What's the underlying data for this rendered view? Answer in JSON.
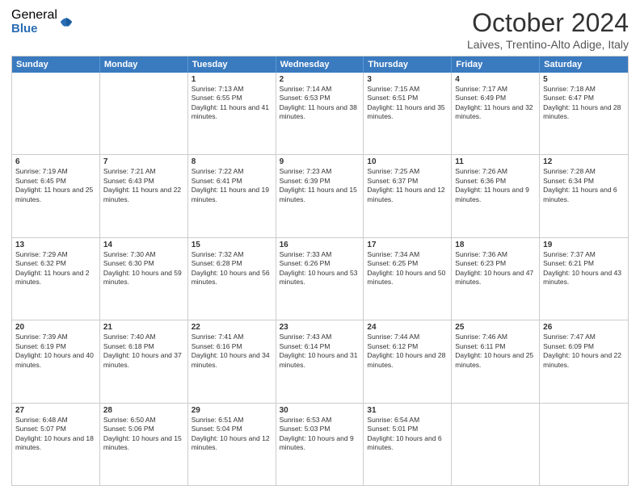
{
  "header": {
    "logo_general": "General",
    "logo_blue": "Blue",
    "month_title": "October 2024",
    "location": "Laives, Trentino-Alto Adige, Italy"
  },
  "days": [
    "Sunday",
    "Monday",
    "Tuesday",
    "Wednesday",
    "Thursday",
    "Friday",
    "Saturday"
  ],
  "weeks": [
    [
      {
        "day": "",
        "info": ""
      },
      {
        "day": "",
        "info": ""
      },
      {
        "day": "1",
        "info": "Sunrise: 7:13 AM\nSunset: 6:55 PM\nDaylight: 11 hours and 41 minutes."
      },
      {
        "day": "2",
        "info": "Sunrise: 7:14 AM\nSunset: 6:53 PM\nDaylight: 11 hours and 38 minutes."
      },
      {
        "day": "3",
        "info": "Sunrise: 7:15 AM\nSunset: 6:51 PM\nDaylight: 11 hours and 35 minutes."
      },
      {
        "day": "4",
        "info": "Sunrise: 7:17 AM\nSunset: 6:49 PM\nDaylight: 11 hours and 32 minutes."
      },
      {
        "day": "5",
        "info": "Sunrise: 7:18 AM\nSunset: 6:47 PM\nDaylight: 11 hours and 28 minutes."
      }
    ],
    [
      {
        "day": "6",
        "info": "Sunrise: 7:19 AM\nSunset: 6:45 PM\nDaylight: 11 hours and 25 minutes."
      },
      {
        "day": "7",
        "info": "Sunrise: 7:21 AM\nSunset: 6:43 PM\nDaylight: 11 hours and 22 minutes."
      },
      {
        "day": "8",
        "info": "Sunrise: 7:22 AM\nSunset: 6:41 PM\nDaylight: 11 hours and 19 minutes."
      },
      {
        "day": "9",
        "info": "Sunrise: 7:23 AM\nSunset: 6:39 PM\nDaylight: 11 hours and 15 minutes."
      },
      {
        "day": "10",
        "info": "Sunrise: 7:25 AM\nSunset: 6:37 PM\nDaylight: 11 hours and 12 minutes."
      },
      {
        "day": "11",
        "info": "Sunrise: 7:26 AM\nSunset: 6:36 PM\nDaylight: 11 hours and 9 minutes."
      },
      {
        "day": "12",
        "info": "Sunrise: 7:28 AM\nSunset: 6:34 PM\nDaylight: 11 hours and 6 minutes."
      }
    ],
    [
      {
        "day": "13",
        "info": "Sunrise: 7:29 AM\nSunset: 6:32 PM\nDaylight: 11 hours and 2 minutes."
      },
      {
        "day": "14",
        "info": "Sunrise: 7:30 AM\nSunset: 6:30 PM\nDaylight: 10 hours and 59 minutes."
      },
      {
        "day": "15",
        "info": "Sunrise: 7:32 AM\nSunset: 6:28 PM\nDaylight: 10 hours and 56 minutes."
      },
      {
        "day": "16",
        "info": "Sunrise: 7:33 AM\nSunset: 6:26 PM\nDaylight: 10 hours and 53 minutes."
      },
      {
        "day": "17",
        "info": "Sunrise: 7:34 AM\nSunset: 6:25 PM\nDaylight: 10 hours and 50 minutes."
      },
      {
        "day": "18",
        "info": "Sunrise: 7:36 AM\nSunset: 6:23 PM\nDaylight: 10 hours and 47 minutes."
      },
      {
        "day": "19",
        "info": "Sunrise: 7:37 AM\nSunset: 6:21 PM\nDaylight: 10 hours and 43 minutes."
      }
    ],
    [
      {
        "day": "20",
        "info": "Sunrise: 7:39 AM\nSunset: 6:19 PM\nDaylight: 10 hours and 40 minutes."
      },
      {
        "day": "21",
        "info": "Sunrise: 7:40 AM\nSunset: 6:18 PM\nDaylight: 10 hours and 37 minutes."
      },
      {
        "day": "22",
        "info": "Sunrise: 7:41 AM\nSunset: 6:16 PM\nDaylight: 10 hours and 34 minutes."
      },
      {
        "day": "23",
        "info": "Sunrise: 7:43 AM\nSunset: 6:14 PM\nDaylight: 10 hours and 31 minutes."
      },
      {
        "day": "24",
        "info": "Sunrise: 7:44 AM\nSunset: 6:12 PM\nDaylight: 10 hours and 28 minutes."
      },
      {
        "day": "25",
        "info": "Sunrise: 7:46 AM\nSunset: 6:11 PM\nDaylight: 10 hours and 25 minutes."
      },
      {
        "day": "26",
        "info": "Sunrise: 7:47 AM\nSunset: 6:09 PM\nDaylight: 10 hours and 22 minutes."
      }
    ],
    [
      {
        "day": "27",
        "info": "Sunrise: 6:48 AM\nSunset: 5:07 PM\nDaylight: 10 hours and 18 minutes."
      },
      {
        "day": "28",
        "info": "Sunrise: 6:50 AM\nSunset: 5:06 PM\nDaylight: 10 hours and 15 minutes."
      },
      {
        "day": "29",
        "info": "Sunrise: 6:51 AM\nSunset: 5:04 PM\nDaylight: 10 hours and 12 minutes."
      },
      {
        "day": "30",
        "info": "Sunrise: 6:53 AM\nSunset: 5:03 PM\nDaylight: 10 hours and 9 minutes."
      },
      {
        "day": "31",
        "info": "Sunrise: 6:54 AM\nSunset: 5:01 PM\nDaylight: 10 hours and 6 minutes."
      },
      {
        "day": "",
        "info": ""
      },
      {
        "day": "",
        "info": ""
      }
    ]
  ]
}
